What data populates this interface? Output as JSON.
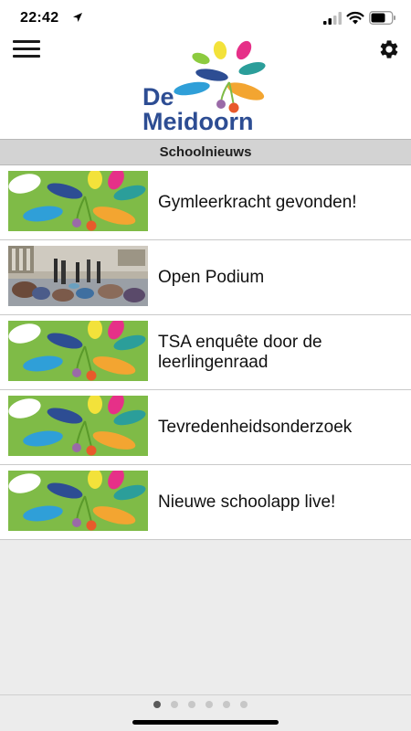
{
  "status_bar": {
    "time": "22:42",
    "icons": [
      "location-arrow-icon",
      "cellular-signal-icon",
      "wifi-icon",
      "battery-icon"
    ]
  },
  "header": {
    "menu_icon": "hamburger-menu-icon",
    "settings_icon": "gear-icon",
    "logo_lines": [
      "De",
      "Meidoorn"
    ]
  },
  "section": {
    "title": "Schoolnieuws"
  },
  "news": [
    {
      "title": "Gymleerkracht gevonden!",
      "thumbnail": "school-logo"
    },
    {
      "title": "Open Podium",
      "thumbnail": "photo-podium"
    },
    {
      "title": "TSA enquête door de leerlingenraad",
      "thumbnail": "school-logo"
    },
    {
      "title": "Tevredenheidsonderzoek",
      "thumbnail": "school-logo"
    },
    {
      "title": "Nieuwe schoolapp live!",
      "thumbnail": "school-logo"
    }
  ],
  "pagination": {
    "total": 6,
    "current": 1
  },
  "colors": {
    "logo_green": "#7fbb47",
    "logo_blue": "#2d4d93",
    "section_bar": "#d3d3d3",
    "background": "#ececec"
  }
}
